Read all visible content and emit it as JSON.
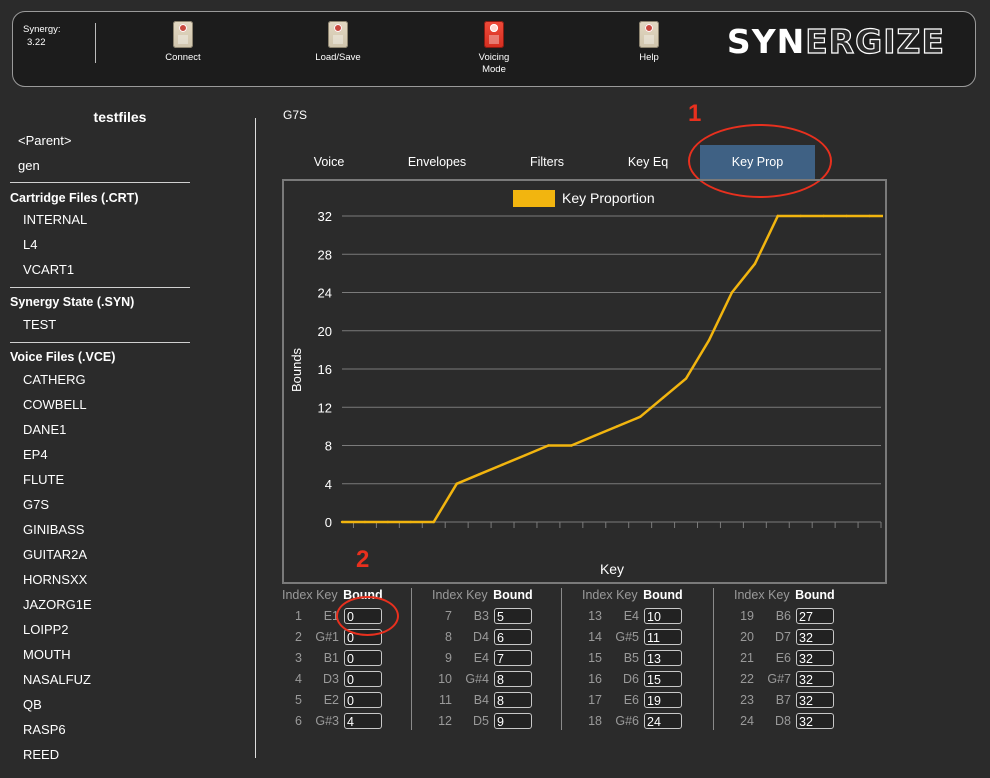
{
  "app": {
    "name_label": "Synergy:",
    "version": "3.22",
    "logo_a": "SYN",
    "logo_b": "ERGIZE",
    "toolbar": [
      {
        "label": "Connect",
        "icon": "connect-icon"
      },
      {
        "label": "Load/Save",
        "icon": "load-save-icon"
      },
      {
        "label": "Voicing\nMode",
        "icon": "voicing-mode-icon"
      },
      {
        "label": "Help",
        "icon": "help-icon"
      }
    ]
  },
  "sidebar": {
    "title": "testfiles",
    "nav": [
      "<Parent>",
      "gen"
    ],
    "sections": [
      {
        "heading": "Cartridge Files (.CRT)",
        "items": [
          "INTERNAL",
          "L4",
          "VCART1"
        ]
      },
      {
        "heading": "Synergy State (.SYN)",
        "items": [
          "TEST"
        ]
      },
      {
        "heading": "Voice Files (.VCE)",
        "items": [
          "CATHERG",
          "COWBELL",
          "DANE1",
          "EP4",
          "FLUTE",
          "G7S",
          "GINIBASS",
          "GUITAR2A",
          "HORNSXX",
          "JAZORG1E",
          "LOIPP2",
          "MOUTH",
          "NASALFUZ",
          "QB",
          "RASP6",
          "REED"
        ]
      }
    ]
  },
  "main": {
    "voice_name": "G7S",
    "tabs": [
      "Voice",
      "Envelopes",
      "Filters",
      "Key Eq",
      "Key Prop"
    ],
    "active_tab": "Key Prop",
    "annotations": [
      "1",
      "2"
    ],
    "table": {
      "headers": {
        "index": "Index",
        "key": "Key",
        "bound": "Bound"
      },
      "rows": [
        {
          "index": "1",
          "key": "E1",
          "bound": "0"
        },
        {
          "index": "2",
          "key": "G#1",
          "bound": "0"
        },
        {
          "index": "3",
          "key": "B1",
          "bound": "0"
        },
        {
          "index": "4",
          "key": "D3",
          "bound": "0"
        },
        {
          "index": "5",
          "key": "E2",
          "bound": "0"
        },
        {
          "index": "6",
          "key": "G#3",
          "bound": "4"
        },
        {
          "index": "7",
          "key": "B3",
          "bound": "5"
        },
        {
          "index": "8",
          "key": "D4",
          "bound": "6"
        },
        {
          "index": "9",
          "key": "E4",
          "bound": "7"
        },
        {
          "index": "10",
          "key": "G#4",
          "bound": "8"
        },
        {
          "index": "11",
          "key": "B4",
          "bound": "8"
        },
        {
          "index": "12",
          "key": "D5",
          "bound": "9"
        },
        {
          "index": "13",
          "key": "E4",
          "bound": "10"
        },
        {
          "index": "14",
          "key": "G#5",
          "bound": "11"
        },
        {
          "index": "15",
          "key": "B5",
          "bound": "13"
        },
        {
          "index": "16",
          "key": "D6",
          "bound": "15"
        },
        {
          "index": "17",
          "key": "E6",
          "bound": "19"
        },
        {
          "index": "18",
          "key": "G#6",
          "bound": "24"
        },
        {
          "index": "19",
          "key": "B6",
          "bound": "27"
        },
        {
          "index": "20",
          "key": "D7",
          "bound": "32"
        },
        {
          "index": "21",
          "key": "E6",
          "bound": "32"
        },
        {
          "index": "22",
          "key": "G#7",
          "bound": "32"
        },
        {
          "index": "23",
          "key": "B7",
          "bound": "32"
        },
        {
          "index": "24",
          "key": "D8",
          "bound": "32"
        }
      ]
    }
  },
  "colors": {
    "accent_tab": "#3f6184",
    "series": "#f2b50f",
    "annotation": "#e8301e"
  },
  "chart_data": {
    "type": "line",
    "xlabel": "Key",
    "ylabel": "Bounds",
    "ylim": [
      0,
      32
    ],
    "yticks": [
      0,
      4,
      8,
      12,
      16,
      20,
      24,
      28,
      32
    ],
    "grid": true,
    "legend_position": "top",
    "series": [
      {
        "name": "Key Proportion",
        "values": [
          0,
          0,
          0,
          0,
          0,
          4,
          5,
          6,
          7,
          8,
          8,
          9,
          10,
          11,
          13,
          15,
          19,
          24,
          27,
          32,
          32,
          32,
          32,
          32
        ]
      }
    ]
  }
}
